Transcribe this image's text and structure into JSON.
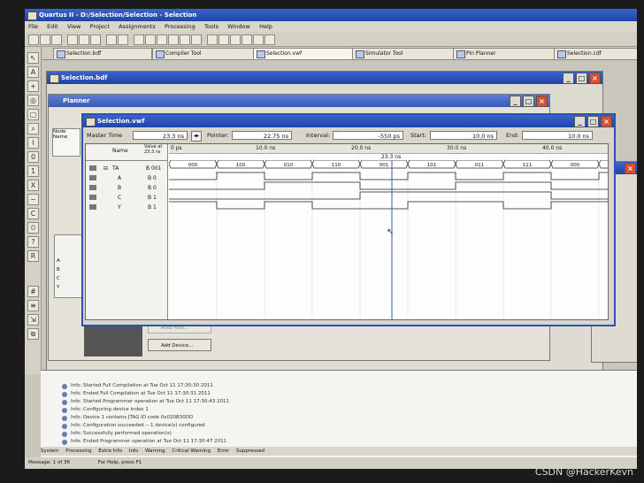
{
  "app": {
    "title": "Quartus II - D:/Selection/Selection - Selection",
    "menu": [
      "File",
      "Edit",
      "View",
      "Project",
      "Assignments",
      "Processing",
      "Tools",
      "Window",
      "Help"
    ]
  },
  "tabs": [
    {
      "label": "Selection.bdf"
    },
    {
      "label": "Compiler Tool"
    },
    {
      "label": "Selection.vwf"
    },
    {
      "label": "Simulator Tool"
    },
    {
      "label": "Pin Planner"
    },
    {
      "label": "Selection.cdf"
    }
  ],
  "windows": {
    "bdf_title": "Selection.bdf",
    "planner_title": "Planner",
    "node_name_header": "Node Name",
    "vwf_title": "Selection.vwf",
    "add_device": "Add Device...",
    "auto_file": "Auto Files..."
  },
  "waveform": {
    "master_time_label": "Master Time",
    "master_time_value": "23.3 ns",
    "pointer_label": "Pointer:",
    "pointer_value": "22.75 ns",
    "interval_label": "Interval:",
    "interval_value": "-550 ps",
    "start_label": "Start:",
    "start_value": "10.0 ns",
    "end_label": "End:",
    "end_value": "10.0 ns",
    "col_name": "Name",
    "col_value": "Value at 23.3 ns",
    "ruler": [
      "0 ps",
      "10.0 ns",
      "20.0 ns",
      "30.0 ns",
      "40.0 ns"
    ],
    "cursor_label": "23.3 ns",
    "signals": [
      {
        "name": "TA",
        "value": "B 001"
      },
      {
        "name": "A",
        "value": "B 0"
      },
      {
        "name": "B",
        "value": "B 0"
      },
      {
        "name": "C",
        "value": "B 1"
      },
      {
        "name": "Y",
        "value": "B 1"
      }
    ],
    "bus_values": [
      "000",
      "100",
      "010",
      "110",
      "001",
      "101",
      "011",
      "111",
      "000",
      "100"
    ]
  },
  "planner_nodes": [
    "A",
    "B",
    "C",
    "Y"
  ],
  "log": [
    "Info: Started Full Compilation at Tue Oct 11 17:30:30 2011",
    "Info: Ended Full Compilation at Tue Oct 11 17:30:31 2011",
    "Info: Started Programmer operation at Tue Oct 11 17:30:43 2011",
    "Info: Configuring device index 1",
    "Info: Device 1 contains JTAG ID code 0x020B30DD",
    "Info: Configuration succeeded -- 1 device(s) configured",
    "Info: Successfully performed operation(s)",
    "Info: Ended Programmer operation at Tue Oct 11 17:30:47 2011"
  ],
  "bottom_tabs": [
    "System",
    "Processing",
    "Extra Info",
    "Info",
    "Warning",
    "Critical Warning",
    "Error",
    "Suppressed"
  ],
  "message_bar": "Message: 1 of 36",
  "status": "For Help, press F1",
  "watermark": "CSDN @HackerKevn"
}
